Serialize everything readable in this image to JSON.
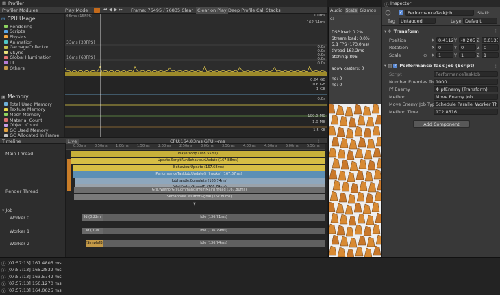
{
  "profiler": {
    "tab_title": "Profiler",
    "modules_label": "Profiler Modules",
    "play_mode": "Play Mode",
    "frame_label": "Frame: 76495 / 76835",
    "clear": "Clear",
    "clear_on_play": "Clear on Play",
    "deep_profile": "Deep Profile",
    "call_stacks": "Call Stacks",
    "cpu_usage": {
      "title": "CPU Usage",
      "categories": [
        {
          "label": "Rendering",
          "color": "#8dd35f"
        },
        {
          "label": "Scripts",
          "color": "#5ba7e8"
        },
        {
          "label": "Physics",
          "color": "#f5a742"
        },
        {
          "label": "Animation",
          "color": "#4fc7c7"
        },
        {
          "label": "GarbageCollector",
          "color": "#c4c04b"
        },
        {
          "label": "VSync",
          "color": "#e8e27a"
        },
        {
          "label": "Global Illumination",
          "color": "#e57373"
        },
        {
          "label": "UI",
          "color": "#b47cd6"
        },
        {
          "label": "Others",
          "color": "#c49a48"
        }
      ],
      "guide_30fps": "33ms (30FPS)",
      "guide_60fps": "16ms (60FPS)",
      "top_label": "66ms (15FPS)"
    },
    "memory": {
      "title": "Memory",
      "categories": [
        {
          "label": "Total Used Memory",
          "color": "#6eb0d8"
        },
        {
          "label": "Texture Memory",
          "color": "#e9d64b"
        },
        {
          "label": "Mesh Memory",
          "color": "#8dd35f"
        },
        {
          "label": "Material Count",
          "color": "#e07070"
        },
        {
          "label": "Object Count",
          "color": "#c79ee8"
        },
        {
          "label": "GC Used Memory",
          "color": "#e0a040"
        },
        {
          "label": "GC Allocated In Frame",
          "color": "#c0c0c0"
        }
      ]
    },
    "right_axis": [
      "1.0ms",
      "162.34ms",
      "0.0s",
      "0.0s",
      "0.0s",
      "0.0s",
      "0.0s",
      "0.64 GB",
      "0.6 GB",
      "1 GB",
      "0.0s",
      "100.5 MB",
      "1.0 MB",
      "1.5 KB"
    ],
    "timeline": {
      "label": "Timeline",
      "live": "Live",
      "cpu_time": "CPU:164.83ms  GPU:--ms",
      "ticks": [
        "0.00ms",
        "0.50ms",
        "1.00ms",
        "1.50ms",
        "2.00ms",
        "2.50ms",
        "3.00ms",
        "3.50ms",
        "4.00ms",
        "4.50ms",
        "5.00ms",
        "5.50ms"
      ],
      "threads": [
        "Main Thread",
        "Render Thread",
        "Job",
        "Worker 0",
        "Worker 1",
        "Worker 2"
      ],
      "main_bars": [
        "PlayerLoop (168.55ms)",
        "Update.ScriptRunBehaviourUpdate (167.88ms)",
        "BehaviourUpdate (167.68ms)",
        "PerformanceTaskJob.Update() [Invoke] (167.67ms)",
        "JobHandle.Complete (166.74ms)",
        "WaitForJobGroupID (166.74ms)"
      ],
      "render_bars": [
        "Gfx.WaitForGfxCommandsFromMainThread (167.80ms)",
        "Semaphore.WaitForSignal (167.80ms)"
      ],
      "worker0": {
        "small": "Id (0.22m",
        "idle": "Idle (136.71ms)"
      },
      "worker1": {
        "small": "Id (0.2s",
        "idle": "Idle (136.79ms)"
      },
      "worker2": {
        "small": "[Simple]B",
        "idle": "Idle (136.74ms)"
      }
    },
    "console": [
      "[07:57:13] 167.4805 ms",
      "[07:57:13] 165.2832 ms",
      "[07:57:13] 163.5742 ms",
      "[07:57:13] 156.1270 ms",
      "[07:57:13] 164.0625 ms"
    ]
  },
  "game": {
    "tabs": [
      "Audio",
      "Stats",
      "Gizmos"
    ],
    "stats": [
      "DSP load: 0.2%",
      "Stream load: 0.0%",
      "5.8 FPS (173.0ms)",
      "thread 163.2ms",
      "atching: 896",
      "adow casters: 0",
      "ng: 0",
      "ng: 0"
    ],
    "stats_header": "cs"
  },
  "inspector": {
    "tab": "Inspector",
    "object_name": "PerformanceTaskJob",
    "static": "Static",
    "tag_label": "Tag",
    "tag_value": "Untagged",
    "layer_label": "Layer",
    "layer_value": "Default",
    "transform": {
      "title": "Transform",
      "position": {
        "label": "Position",
        "x": "0.4112",
        "y": "-0.205",
        "z": "0.0135"
      },
      "rotation": {
        "label": "Rotation",
        "x": "0",
        "y": "0",
        "z": "0"
      },
      "scale": {
        "label": "Scale",
        "x": "1",
        "y": "1",
        "z": "1"
      }
    },
    "script_component": {
      "title": "Performance Task Job (Script)",
      "script_label": "Script",
      "script_value": "PerformanceTaskJob",
      "enemies_label": "Number Enemies To C",
      "enemies_value": "1000",
      "pf_label": "Pf Enemy",
      "pf_value": "pfEnemy (Transform)",
      "method_label": "Method",
      "method_value": "Move Enemy Job",
      "move_label": "Move Enemy Job Typ",
      "move_value": "Schedule Parallel Worker Thr",
      "time_label": "Method Time",
      "time_value": "172.8516"
    },
    "add_component": "Add Component"
  }
}
